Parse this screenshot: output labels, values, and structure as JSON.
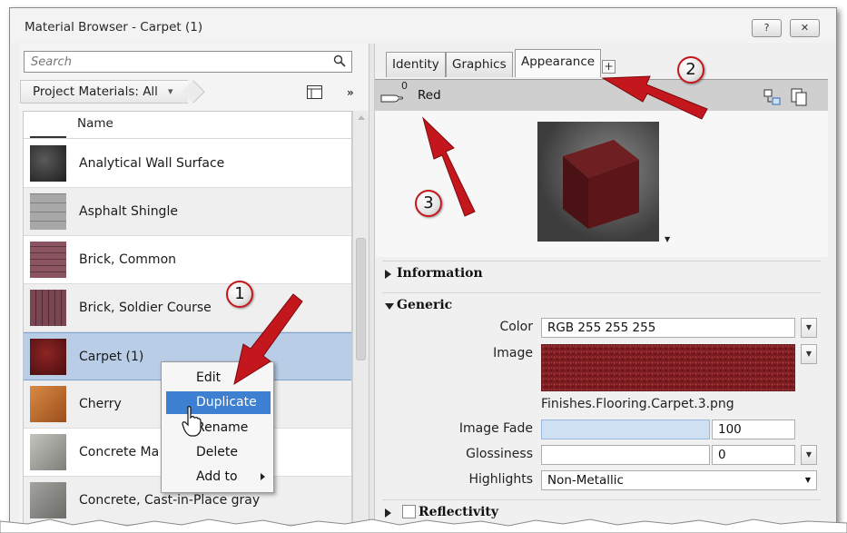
{
  "window": {
    "title": "Material Browser - Carpet (1)",
    "help_label": "?",
    "close_label": "✕"
  },
  "search": {
    "placeholder": "Search"
  },
  "filter": {
    "label": "Project Materials: All",
    "dropdown_glyph": "▾",
    "more_glyph": "»"
  },
  "list": {
    "header": "Name",
    "rows": [
      {
        "label": "Analytical Wall Surface",
        "thumb_color": "#3a3a3a"
      },
      {
        "label": "Asphalt Shingle",
        "thumb_color": "#9a9a9a"
      },
      {
        "label": "Brick, Common",
        "thumb_color": "#7b4a52"
      },
      {
        "label": "Brick, Soldier Course",
        "thumb_color": "#6d3f48"
      },
      {
        "label": "Carpet (1)",
        "thumb_color": "#7a1c1c"
      },
      {
        "label": "Cherry",
        "thumb_color": "#c06a2a"
      },
      {
        "label": "Concrete Ma",
        "thumb_color": "#a9a9a4"
      },
      {
        "label": "Concrete, Cast-in-Place gray",
        "thumb_color": "#8a8a86"
      }
    ]
  },
  "context_menu": {
    "items": [
      "Edit",
      "Duplicate",
      "Rename",
      "Delete",
      "Add to"
    ],
    "highlighted": "Duplicate"
  },
  "tabs": {
    "items": [
      "Identity",
      "Graphics",
      "Appearance"
    ],
    "active": "Appearance",
    "add_label": "+"
  },
  "asset": {
    "count": "0",
    "name": "Red"
  },
  "sections": {
    "information": "Information",
    "generic": "Generic",
    "reflectivity": "Reflectivity"
  },
  "properties": {
    "color_label": "Color",
    "color_value": "RGB 255 255 255",
    "image_label": "Image",
    "image_file": "Finishes.Flooring.Carpet.3.png",
    "image_fade_label": "Image Fade",
    "image_fade_value": "100",
    "image_fade_level": 1.0,
    "glossiness_label": "Glossiness",
    "glossiness_value": "0",
    "highlights_label": "Highlights",
    "highlights_value": "Non-Metallic"
  },
  "callouts": [
    "1",
    "2",
    "3"
  ],
  "colors": {
    "accent_red": "#c4171d",
    "selection": "#b9cde6",
    "menu_highlight": "#3d7fd0",
    "carpet": "#7a1c1c"
  }
}
